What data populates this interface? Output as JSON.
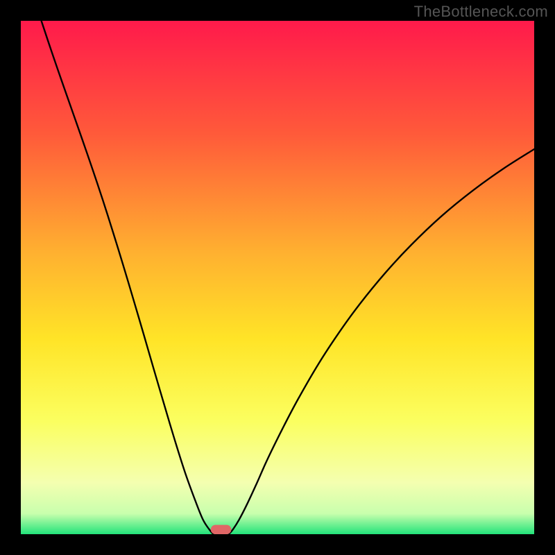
{
  "watermark": "TheBottleneck.com",
  "chart_data": {
    "type": "line",
    "title": "",
    "xlabel": "",
    "ylabel": "",
    "xlim": [
      0,
      100
    ],
    "ylim": [
      0,
      100
    ],
    "gradient_stops": [
      {
        "offset": 0,
        "color": "#ff1a4b"
      },
      {
        "offset": 22,
        "color": "#ff5a3a"
      },
      {
        "offset": 45,
        "color": "#ffb030"
      },
      {
        "offset": 62,
        "color": "#ffe427"
      },
      {
        "offset": 78,
        "color": "#fbff60"
      },
      {
        "offset": 90,
        "color": "#f4ffb0"
      },
      {
        "offset": 96,
        "color": "#c8ffad"
      },
      {
        "offset": 100,
        "color": "#22e37a"
      }
    ],
    "series": [
      {
        "name": "left-curve",
        "x": [
          4,
          6,
          8,
          10,
          12,
          14,
          16,
          18,
          20,
          22,
          24,
          26,
          28,
          30,
          32,
          34,
          35.5,
          36.8,
          37.5
        ],
        "y": [
          100,
          94,
          88.2,
          82.5,
          76.8,
          71,
          65,
          58.7,
          52.2,
          45.5,
          38.7,
          31.8,
          25,
          18.3,
          12,
          6.5,
          2.8,
          0.8,
          0
        ]
      },
      {
        "name": "right-curve",
        "x": [
          40.5,
          41.3,
          42.5,
          44,
          46,
          48,
          51,
          54,
          58,
          62,
          66,
          71,
          76,
          82,
          88,
          94,
          100
        ],
        "y": [
          0,
          0.9,
          2.8,
          5.7,
          10.0,
          14.5,
          20.6,
          26.3,
          33.2,
          39.3,
          44.8,
          50.9,
          56.3,
          62.0,
          66.9,
          71.2,
          75.0
        ]
      }
    ],
    "marker": {
      "name": "bottleneck-marker",
      "x_center": 39,
      "width": 4.0,
      "height": 1.8,
      "color": "#e06666"
    }
  }
}
